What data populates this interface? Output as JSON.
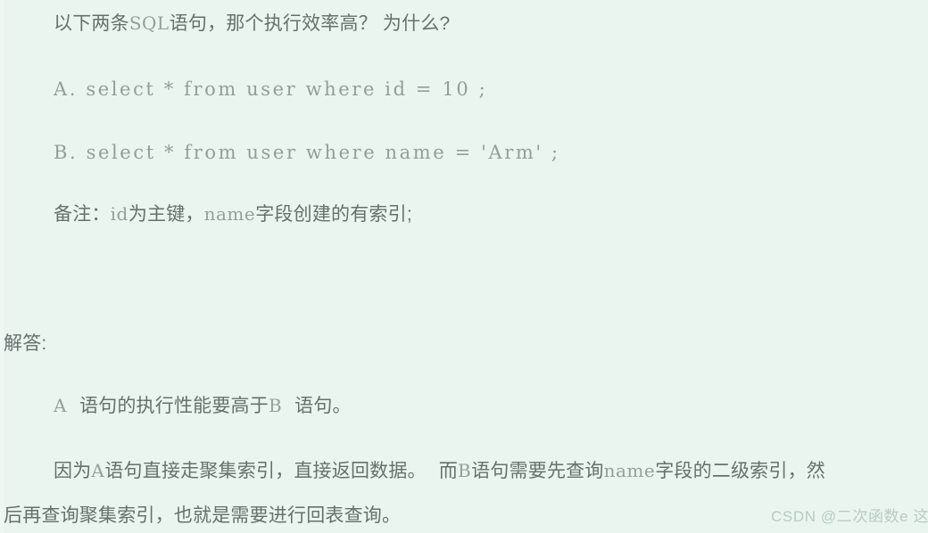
{
  "page": {
    "background_color": "#eaf5f0",
    "cjk_text_color": "#66716e",
    "mono_text_color": "#939e9b",
    "watermark_color": "#b9cac4"
  },
  "question": {
    "lead_cjk": "以下两条",
    "lead_mono": "SQL",
    "lead_tail": "语句，那个执行效率高？ 为什么?"
  },
  "options": {
    "a": "A. select * from user where id = 10 ;",
    "b": "B. select * from user where name = 'Arm' ;"
  },
  "note": {
    "label": "备注：",
    "field_id": "id",
    "mid": "为主键，",
    "field_name": "name",
    "tail": "字段创建的有索引;"
  },
  "answer": {
    "heading": "解答:",
    "line1": {
      "mark_a": "A",
      "mid": "语句的执行性能要高于",
      "mark_b": "B",
      "tail": "语句。"
    },
    "line2": {
      "seg1": "因为",
      "mark_a": "A",
      "seg2": "语句直接走聚集索引，直接返回数据。",
      "seg3": "而",
      "mark_b": "B",
      "seg4": "语句需要先查询",
      "field_name": "name",
      "seg5": "字段的二级索引，然"
    },
    "line3": "后再查询聚集索引，也就是需要进行回表查询。"
  },
  "watermark": {
    "text": "CSDN @二次函数e 这"
  }
}
